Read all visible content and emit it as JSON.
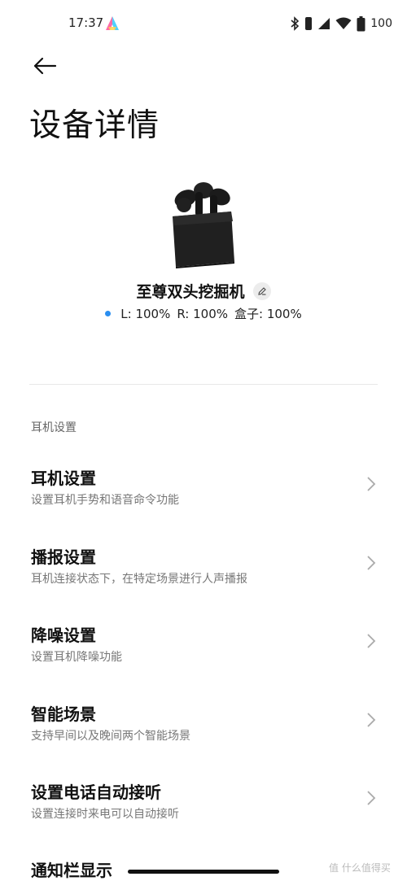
{
  "status_bar": {
    "time": "17:37",
    "battery": "100"
  },
  "header": {
    "title": "设备详情"
  },
  "device": {
    "name": "至尊双头挖掘机",
    "battery": {
      "left": "L: 100%",
      "right": "R: 100%",
      "case": "盒子: 100%"
    }
  },
  "section": {
    "label": "耳机设置"
  },
  "menu": [
    {
      "title": "耳机设置",
      "desc": "设置耳机手势和语音命令功能"
    },
    {
      "title": "播报设置",
      "desc": "耳机连接状态下，在特定场景进行人声播报"
    },
    {
      "title": "降噪设置",
      "desc": "设置耳机降噪功能"
    },
    {
      "title": "智能场景",
      "desc": "支持早间以及晚间两个智能场景"
    },
    {
      "title": "设置电话自动接听",
      "desc": "设置连接时来电可以自动接听"
    },
    {
      "title": "通知栏显示",
      "desc": ""
    }
  ],
  "watermark": "值 什么值得买",
  "colors": {
    "accent_dot": "#2a8ef0",
    "text_primary": "#111111",
    "text_secondary": "#777777"
  }
}
